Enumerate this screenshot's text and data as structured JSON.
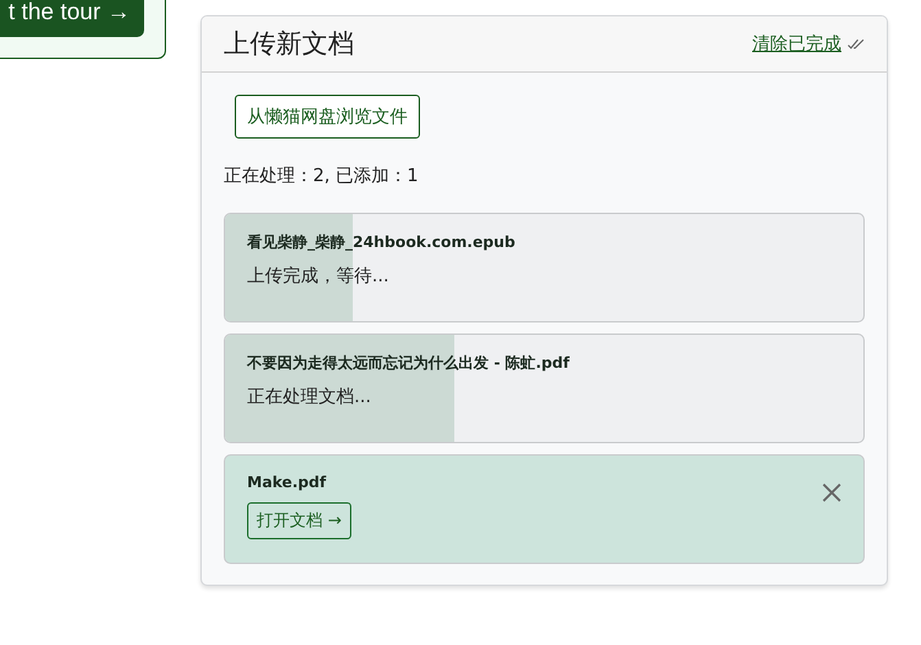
{
  "tour_button": {
    "label": "t the tour →"
  },
  "panel": {
    "title": "上传新文档",
    "clear_link": "清除已完成"
  },
  "browse_button": {
    "label": "从懒猫网盘浏览文件"
  },
  "status": "正在处理：2, 已添加：1",
  "uploads": [
    {
      "kind": "progress",
      "filename": "看见柴静_柴静_24hbook.com.epub",
      "message": "上传完成，等待...",
      "level": 0.2
    },
    {
      "kind": "progress",
      "filename": "不要因为走得太远而忘记为什么出发 - 陈虻.pdf",
      "message": "正在处理文档...",
      "level": 0.36
    },
    {
      "kind": "done",
      "filename": "Make.pdf",
      "action": "打开文档 →"
    }
  ]
}
